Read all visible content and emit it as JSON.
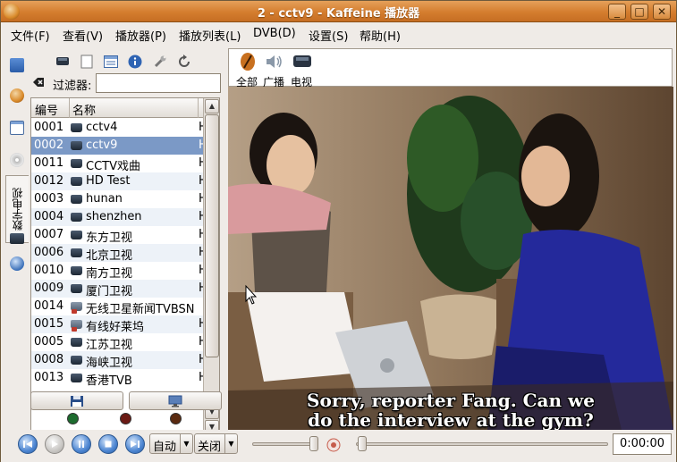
{
  "window": {
    "title": "2 - cctv9 - Kaffeine 播放器",
    "buttons": [
      "_",
      "□",
      "✕"
    ]
  },
  "menu": [
    {
      "label": "文件(F)"
    },
    {
      "label": "查看(V)"
    },
    {
      "label": "播放器(P)"
    },
    {
      "label": "播放列表(L)"
    },
    {
      "label": "DVB(D)"
    },
    {
      "label": "设置(S)"
    },
    {
      "label": "帮助(H)"
    }
  ],
  "side_tabs": {
    "active_label": "数字电视"
  },
  "left_panel": {
    "toolbar_icons": [
      "tv-icon",
      "document-icon",
      "list-icon",
      "info-icon",
      "wrench-icon",
      "refresh-icon"
    ],
    "filter_label": "过滤器:",
    "filter_value": "",
    "columns": [
      "编号",
      "名称"
    ],
    "channels": [
      {
        "num": "0001",
        "name": "cctv4",
        "extra": "H",
        "type": "tv"
      },
      {
        "num": "0002",
        "name": "cctv9",
        "extra": "H",
        "type": "tv",
        "selected": true
      },
      {
        "num": "0011",
        "name": "CCTV戏曲",
        "extra": "H",
        "type": "tv"
      },
      {
        "num": "0012",
        "name": "HD Test",
        "extra": "H",
        "type": "tv"
      },
      {
        "num": "0003",
        "name": "hunan",
        "extra": "H",
        "type": "tv"
      },
      {
        "num": "0004",
        "name": "shenzhen",
        "extra": "H",
        "type": "tv"
      },
      {
        "num": "0007",
        "name": "东方卫视",
        "extra": "H",
        "type": "tv"
      },
      {
        "num": "0006",
        "name": "北京卫视",
        "extra": "H",
        "type": "tv"
      },
      {
        "num": "0010",
        "name": "南方卫视",
        "extra": "H",
        "type": "tv"
      },
      {
        "num": "0009",
        "name": "厦门卫视",
        "extra": "H",
        "type": "tv"
      },
      {
        "num": "0014",
        "name": "无线卫星新闻TVBSN",
        "extra": "",
        "type": "radio"
      },
      {
        "num": "0015",
        "name": "有线好莱坞",
        "extra": "H",
        "type": "radio"
      },
      {
        "num": "0005",
        "name": "江苏卫视",
        "extra": "H",
        "type": "tv"
      },
      {
        "num": "0008",
        "name": "海峡卫视",
        "extra": "H",
        "type": "tv"
      },
      {
        "num": "0013",
        "name": "香港TVB",
        "extra": "H",
        "type": "tv"
      }
    ],
    "leds": [
      "#1d6b2e",
      "#6b1a14",
      "#5a2a10"
    ]
  },
  "right_panel": {
    "channel_tabs": [
      {
        "label": "全部",
        "icon": "kaffeine-icon"
      },
      {
        "label": "广播",
        "icon": "speaker-icon"
      },
      {
        "label": "电视",
        "icon": "tv-icon"
      }
    ],
    "subtitle_line1": "Sorry, reporter Fang. Can we",
    "subtitle_line2": "do the interview at the gym?"
  },
  "controls": {
    "buttons": [
      "previous-icon",
      "play-icon",
      "pause-icon",
      "stop-icon",
      "next-icon"
    ],
    "aspect_value": "自动",
    "deinterlace_value": "关闭",
    "volume_level": 0.75,
    "position_level": 0,
    "time": "0:00:00"
  }
}
